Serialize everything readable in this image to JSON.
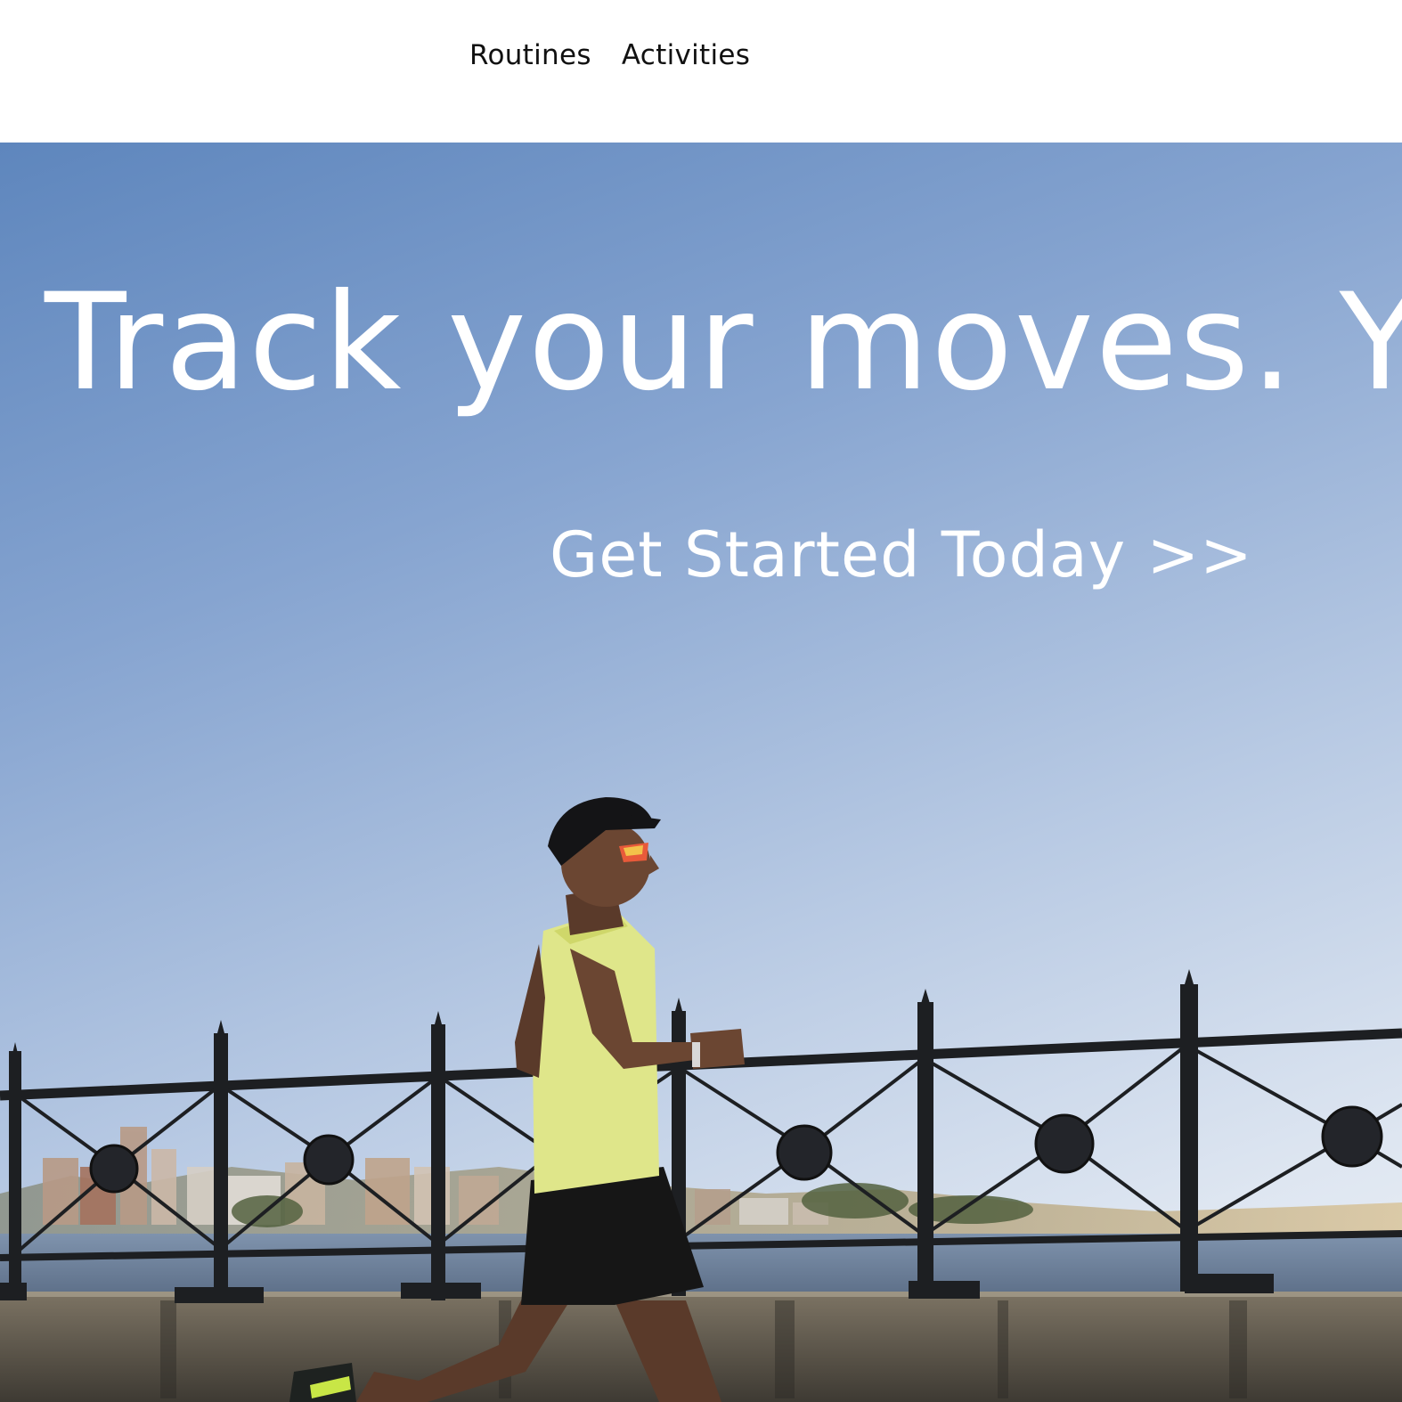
{
  "nav": {
    "items": [
      {
        "label": "Routines"
      },
      {
        "label": "Activities"
      }
    ]
  },
  "hero": {
    "headline": "Track your moves. Your",
    "cta_label": "Get Started Today >>",
    "image": "runner-on-harbour-promenade",
    "colors": {
      "sky_top": "#5e86bd",
      "sky_bottom": "#eef2f7",
      "text": "#ffffff",
      "tank_top": "#dfe68a"
    }
  }
}
